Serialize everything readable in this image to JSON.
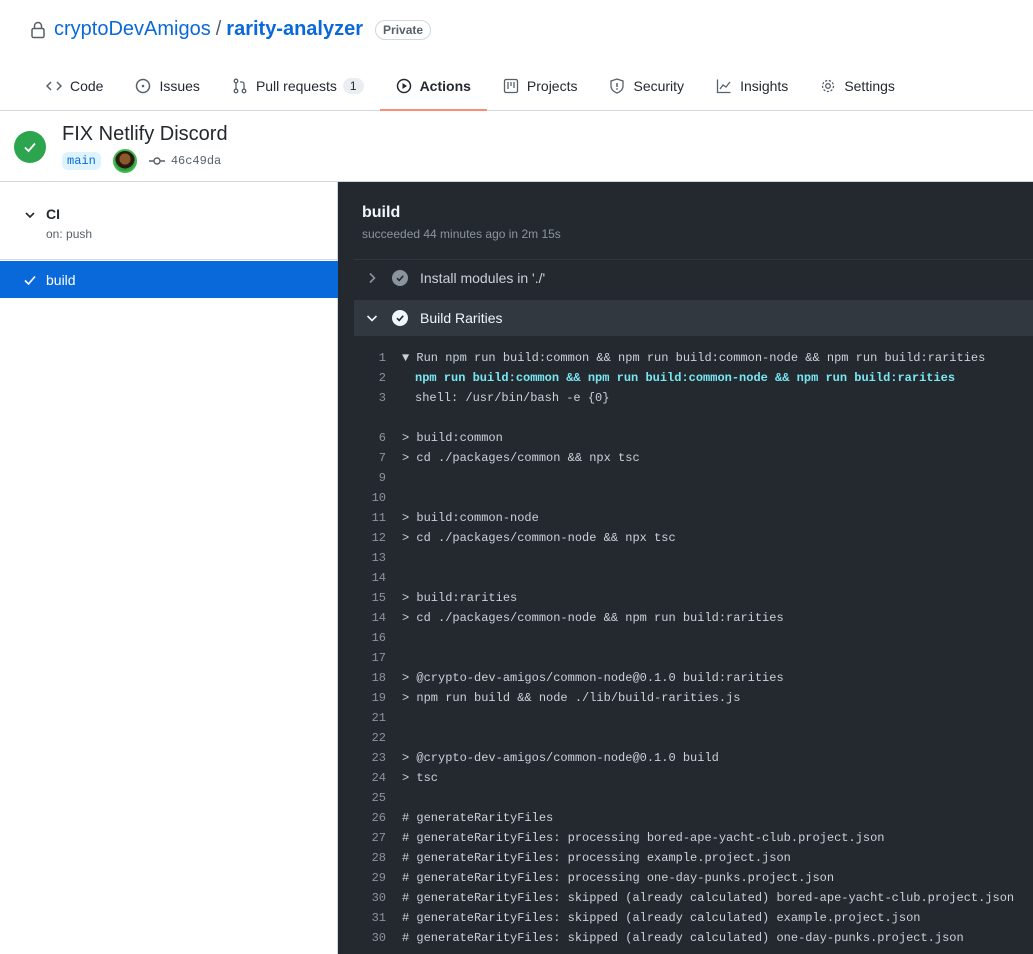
{
  "repo": {
    "owner": "cryptoDevAmigos",
    "separator": "/",
    "name": "rarity-analyzer",
    "visibility": "Private"
  },
  "tabs": [
    {
      "label": "Code",
      "icon": "code-icon"
    },
    {
      "label": "Issues",
      "icon": "issue-icon"
    },
    {
      "label": "Pull requests",
      "icon": "pull-request-icon",
      "count": "1"
    },
    {
      "label": "Actions",
      "icon": "play-icon",
      "active": true
    },
    {
      "label": "Projects",
      "icon": "project-icon"
    },
    {
      "label": "Security",
      "icon": "shield-icon"
    },
    {
      "label": "Insights",
      "icon": "graph-icon"
    },
    {
      "label": "Settings",
      "icon": "gear-icon"
    }
  ],
  "run": {
    "title": "FIX Netlify Discord",
    "branch": "main",
    "sha": "46c49da",
    "status": "success",
    "status_color": "#2da44e"
  },
  "sidebar": {
    "workflow_name": "CI",
    "trigger": "on: push",
    "job_name": "build"
  },
  "log": {
    "job_title": "build",
    "summary": "succeeded 44 minutes ago in 2m 15s",
    "steps": [
      {
        "name": "Install modules in './'",
        "expanded": false
      },
      {
        "name": "Build Rarities",
        "expanded": true
      }
    ],
    "lines": [
      {
        "n": "1",
        "t": "▼ Run npm run build:common && npm run build:common-node && npm run build:rarities",
        "style": "normal"
      },
      {
        "n": "2",
        "t": "npm run build:common && npm run build:common-node && npm run build:rarities",
        "style": "cmd"
      },
      {
        "n": "3",
        "t": "shell: /usr/bin/bash -e {0}",
        "style": "indent"
      },
      {
        "n": "",
        "t": "",
        "style": "normal"
      },
      {
        "n": "6",
        "t": "> build:common",
        "style": "normal"
      },
      {
        "n": "7",
        "t": "> cd ./packages/common && npx tsc",
        "style": "normal"
      },
      {
        "n": "9",
        "t": "",
        "style": "normal"
      },
      {
        "n": "10",
        "t": "",
        "style": "normal"
      },
      {
        "n": "11",
        "t": "> build:common-node",
        "style": "normal"
      },
      {
        "n": "12",
        "t": "> cd ./packages/common-node && npx tsc",
        "style": "normal"
      },
      {
        "n": "13",
        "t": "",
        "style": "normal"
      },
      {
        "n": "14",
        "t": "",
        "style": "normal"
      },
      {
        "n": "15",
        "t": "> build:rarities",
        "style": "normal"
      },
      {
        "n": "14",
        "t": "> cd ./packages/common-node && npm run build:rarities",
        "style": "normal"
      },
      {
        "n": "16",
        "t": "",
        "style": "normal"
      },
      {
        "n": "17",
        "t": "",
        "style": "normal"
      },
      {
        "n": "18",
        "t": "> @crypto-dev-amigos/common-node@0.1.0 build:rarities",
        "style": "normal"
      },
      {
        "n": "19",
        "t": "> npm run build && node ./lib/build-rarities.js",
        "style": "normal"
      },
      {
        "n": "21",
        "t": "",
        "style": "normal"
      },
      {
        "n": "22",
        "t": "",
        "style": "normal"
      },
      {
        "n": "23",
        "t": "> @crypto-dev-amigos/common-node@0.1.0 build",
        "style": "normal"
      },
      {
        "n": "24",
        "t": "> tsc",
        "style": "normal"
      },
      {
        "n": "25",
        "t": "",
        "style": "normal"
      },
      {
        "n": "26",
        "t": "# generateRarityFiles",
        "style": "normal"
      },
      {
        "n": "27",
        "t": "# generateRarityFiles: processing bored-ape-yacht-club.project.json",
        "style": "normal"
      },
      {
        "n": "28",
        "t": "# generateRarityFiles: processing example.project.json",
        "style": "normal"
      },
      {
        "n": "29",
        "t": "# generateRarityFiles: processing one-day-punks.project.json",
        "style": "normal"
      },
      {
        "n": "30",
        "t": "# generateRarityFiles: skipped (already calculated) bored-ape-yacht-club.project.json",
        "style": "normal"
      },
      {
        "n": "31",
        "t": "# generateRarityFiles: skipped (already calculated) example.project.json",
        "style": "normal"
      },
      {
        "n": "30",
        "t": "# generateRarityFiles: skipped (already calculated) one-day-punks.project.json",
        "style": "normal"
      }
    ]
  }
}
